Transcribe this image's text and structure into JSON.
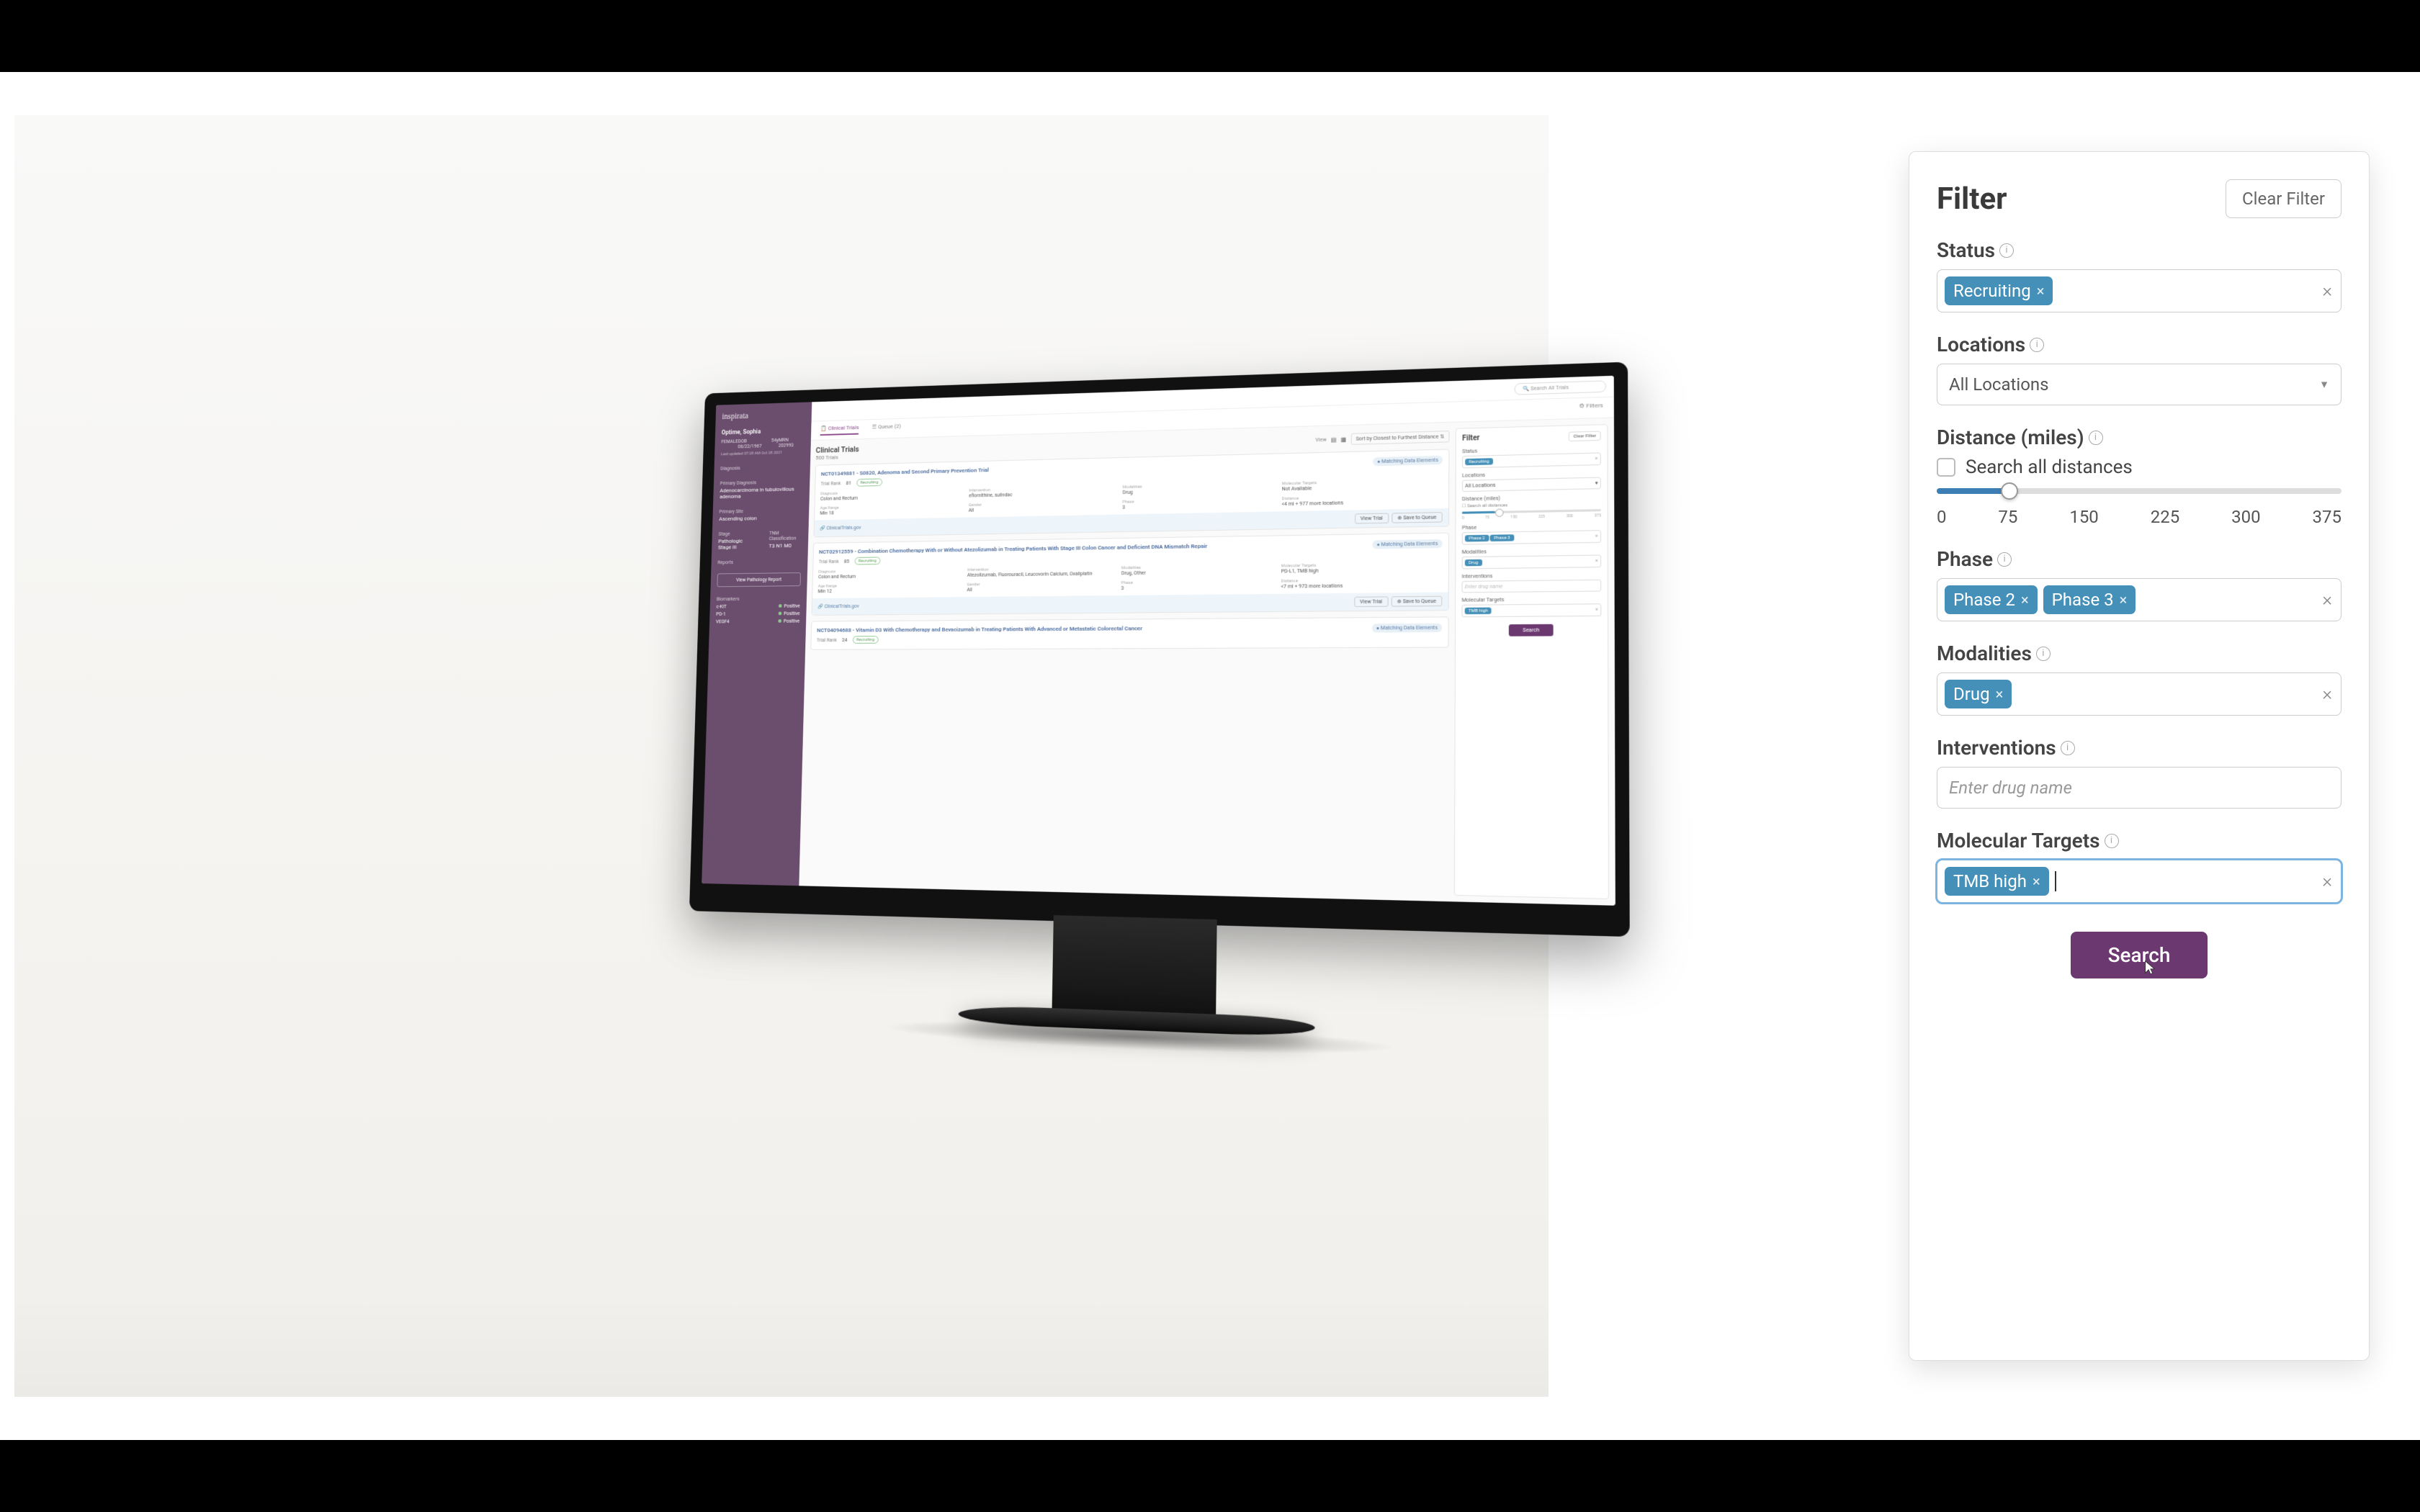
{
  "brand": "inspirata",
  "topbar": {
    "search_placeholder": "Search All Trials"
  },
  "tabs": {
    "clinical": "Clinical Trials",
    "queue": "Queue (2)",
    "filters": "Filters"
  },
  "patient": {
    "name": "Optime, Sophia",
    "sex_label": "FEMALE",
    "dob_label": "DOB",
    "dob": "08/22/1967",
    "age_label": "54y",
    "mrn_label": "MRN",
    "mrn": "202993",
    "updated": "Last updated 07:28 AM Oct 28 2021",
    "diag_label": "Diagnosis",
    "primary_label": "Primary Diagnosis",
    "primary_val": "Adenocarcinoma in tubulovillous adenoma",
    "primary_site_label": "Primary Site",
    "primary_site_val": "Ascending colon",
    "stage_label": "Stage",
    "stage_val": "Pathologic Stage III",
    "tnm_label": "TNM Classification",
    "tnm_val": "T3 N1 M0",
    "reports_label": "Reports",
    "view_report": "View Pathology Report",
    "biomarkers_label": "Biomarkers",
    "biomarkers": [
      {
        "name": "c-KIT",
        "status": "Positive"
      },
      {
        "name": "PD-1",
        "status": "Positive"
      },
      {
        "name": "VEGF4",
        "status": "Positive"
      }
    ]
  },
  "list": {
    "title": "Clinical Trials",
    "count": "500",
    "count_suffix": "Trials",
    "view_label": "View",
    "sort_label": "Sort by Closest to Furthest Distance",
    "matching": "Matching Data Elements",
    "source": "ClinicalTrials.gov",
    "view_trial": "View Trial",
    "save_queue": "Save to Queue"
  },
  "trials": [
    {
      "title": "NCT01349881 - S0820, Adenoma and Second Primary Prevention Trial",
      "rank_label": "Trial Rank",
      "rank": "81",
      "status": "Recruiting",
      "diag_l": "Diagnosis",
      "diag_v": "Colon and Rectum",
      "int_l": "Intervention",
      "int_v": "eflornithine, sulindac",
      "mod_l": "Modalities",
      "mod_v": "Drug",
      "mol_l": "Molecular Targets",
      "mol_v": "Not Available",
      "age_l": "Age Range",
      "age_v": "Min 18",
      "gen_l": "Gender",
      "gen_v": "All",
      "ph_l": "Phase",
      "ph_v": "3",
      "dist_l": "Distance",
      "dist_v": "<4 mi + 977 more locations"
    },
    {
      "title": "NCT02912559 - Combination Chemotherapy With or Without Atezolizumab in Treating Patients With Stage III Colon Cancer and Deficient DNA Mismatch Repair",
      "rank_label": "Trial Rank",
      "rank": "85",
      "status": "Recruiting",
      "diag_l": "Diagnosis",
      "diag_v": "Colon and Rectum",
      "int_l": "Intervention",
      "int_v": "Atezolizumab, Fluorouracil, Leucovorin Calcium, Oxaliplatin",
      "mod_l": "Modalities",
      "mod_v": "Drug, Other",
      "mol_l": "Molecular Targets",
      "mol_v": "PD-L1, TMB high",
      "age_l": "Age Range",
      "age_v": "Min 12",
      "gen_l": "Gender",
      "gen_v": "All",
      "ph_l": "Phase",
      "ph_v": "3",
      "dist_l": "Distance",
      "dist_v": "<7 mi + 973 more locations"
    },
    {
      "title": "NCT04094688 - Vitamin D3 With Chemotherapy and Bevacizumab in Treating Patients With Advanced or Metastatic Colorectal Cancer",
      "rank_label": "Trial Rank",
      "rank": "24",
      "status": "Recruiting"
    }
  ],
  "mini_filter": {
    "title": "Filter",
    "clear": "Clear Filter",
    "status_l": "Status",
    "status_chip": "Recruiting",
    "loc_l": "Locations",
    "loc_v": "All Locations",
    "dist_l": "Distance (miles)",
    "dist_cb": "Search all distances",
    "ticks": [
      "0",
      "75",
      "150",
      "225",
      "300",
      "375"
    ],
    "phase_l": "Phase",
    "p2": "Phase 2",
    "p3": "Phase 3",
    "mod_l": "Modalities",
    "mod_chip": "Drug",
    "int_l": "Interventions",
    "int_ph": "Enter drug name",
    "mol_l": "Molecular Targets",
    "mol_chip": "TMB high",
    "search": "Search"
  },
  "filter_panel": {
    "title": "Filter",
    "clear": "Clear Filter",
    "status_l": "Status",
    "status_chip": "Recruiting",
    "loc_l": "Locations",
    "loc_v": "All Locations",
    "dist_l": "Distance (miles)",
    "dist_cb": "Search all distances",
    "dist_ticks": [
      "0",
      "75",
      "150",
      "225",
      "300",
      "375"
    ],
    "slider_percent": 18,
    "phase_l": "Phase",
    "p2": "Phase 2",
    "p3": "Phase 3",
    "mod_l": "Modalities",
    "mod_chip": "Drug",
    "int_l": "Interventions",
    "int_ph": "Enter drug name",
    "mol_l": "Molecular Targets",
    "mol_chip": "TMB high",
    "search": "Search"
  }
}
